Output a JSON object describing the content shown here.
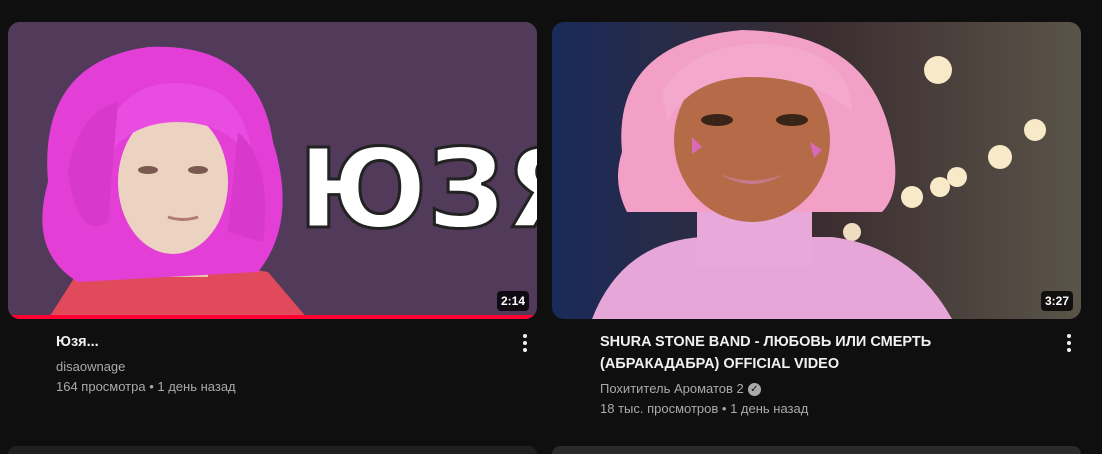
{
  "videos": [
    {
      "title": "Юзя...",
      "thumbnail_text": "ЮЗЯ...",
      "channel": "disaownage",
      "verified": false,
      "stats": "164 просмотра • 1 день назад",
      "duration": "2:14",
      "watched_progress": 1.0
    },
    {
      "title": "SHURA STONE BAND - ЛЮБОВЬ ИЛИ СМЕРТЬ (АБРАКАДАБРА) OFFICIAL VIDEO",
      "channel": "Похититель Ароматов 2",
      "verified": true,
      "stats": "18 тыс. просмотров • 1 день назад",
      "duration": "3:27"
    }
  ],
  "colors": {
    "background": "#0f0f0f",
    "progress": "#ff0033",
    "secondary_text": "#aaaaaa"
  },
  "icons": [
    "more-vert-icon",
    "verified-check-icon"
  ]
}
